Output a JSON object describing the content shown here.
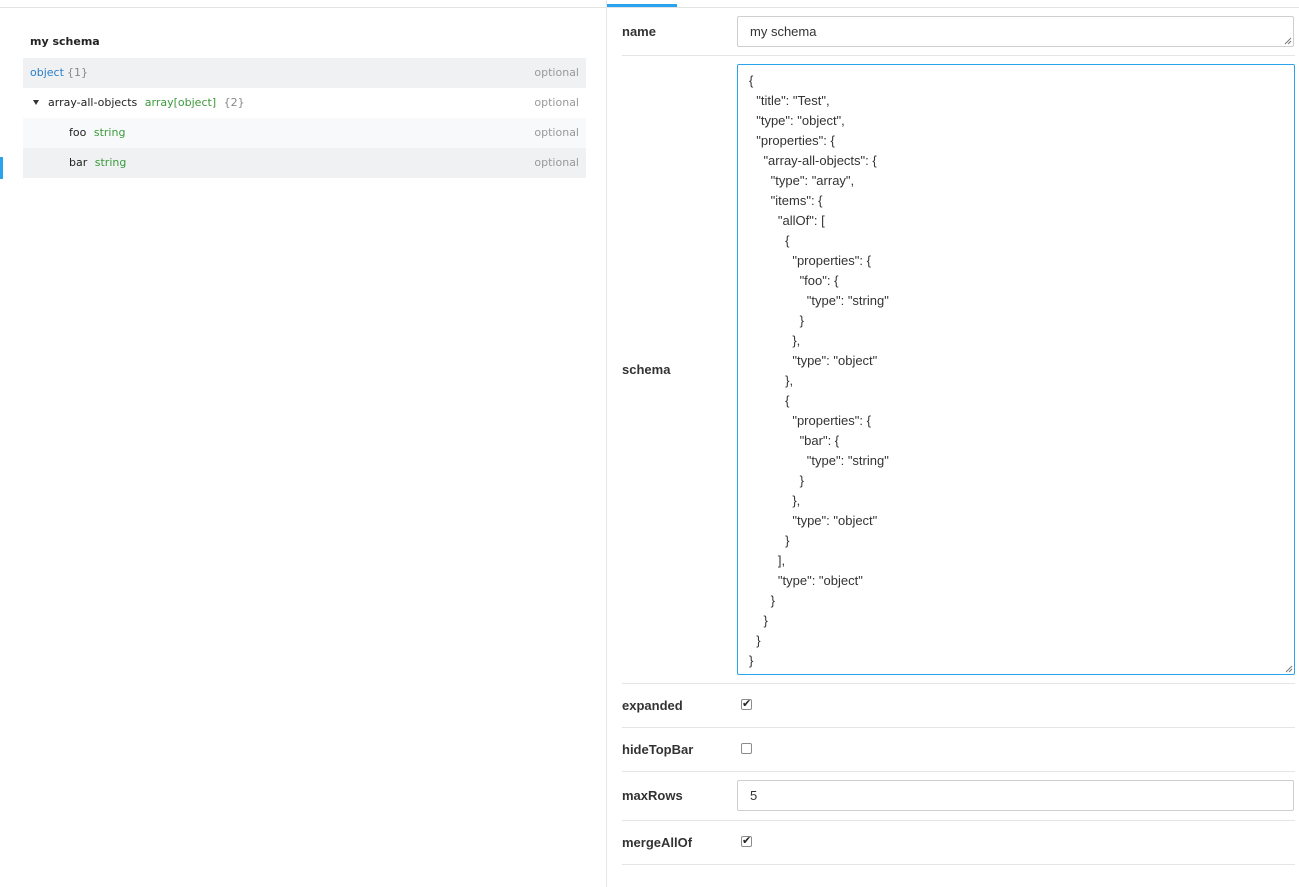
{
  "preview": {
    "schema_title": "my schema",
    "rows": [
      {
        "name": "",
        "type": "object",
        "count": "{1}",
        "required": "optional"
      },
      {
        "name": "array-all-objects",
        "type": "array[object]",
        "count": "{2}",
        "required": "optional"
      },
      {
        "name": "foo",
        "type": "string",
        "count": "",
        "required": "optional"
      },
      {
        "name": "bar",
        "type": "string",
        "count": "",
        "required": "optional"
      }
    ]
  },
  "knobs": {
    "name": {
      "label": "name",
      "value": "my schema"
    },
    "schema": {
      "label": "schema",
      "value": "{\n  \"title\": \"Test\",\n  \"type\": \"object\",\n  \"properties\": {\n    \"array-all-objects\": {\n      \"type\": \"array\",\n      \"items\": {\n        \"allOf\": [\n          {\n            \"properties\": {\n              \"foo\": {\n                \"type\": \"string\"\n              }\n            },\n            \"type\": \"object\"\n          },\n          {\n            \"properties\": {\n              \"bar\": {\n                \"type\": \"string\"\n              }\n            },\n            \"type\": \"object\"\n          }\n        ],\n        \"type\": \"object\"\n      }\n    }\n  }\n}"
    },
    "expanded": {
      "label": "expanded",
      "checked": true,
      "mark": "✔"
    },
    "hideTopBar": {
      "label": "hideTopBar",
      "checked": false,
      "mark": ""
    },
    "maxRows": {
      "label": "maxRows",
      "value": "5"
    },
    "mergeAllOf": {
      "label": "mergeAllOf",
      "checked": true,
      "mark": "✔"
    }
  },
  "colors": {
    "accent": "#2aa3ee",
    "type_object": "#2a7fc6",
    "type_primitive": "#3a9a3a",
    "muted": "#999999"
  }
}
